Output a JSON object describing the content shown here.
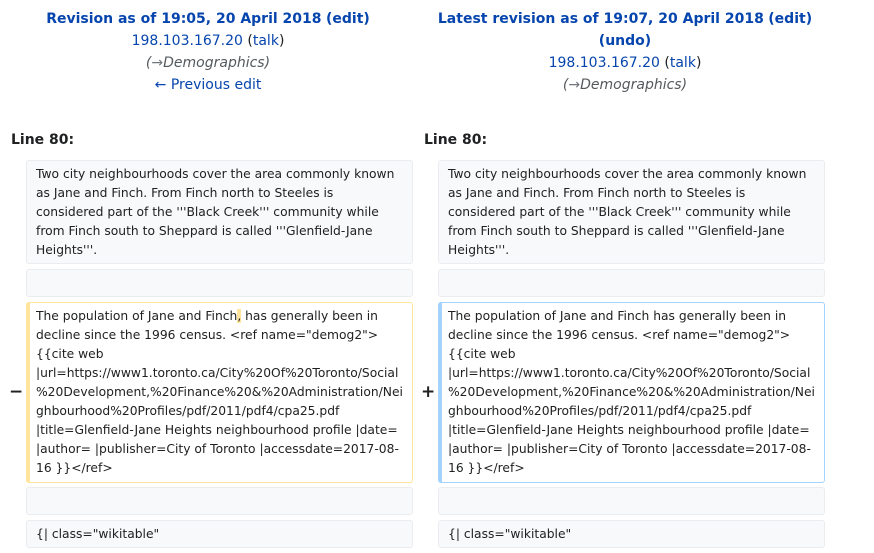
{
  "left_header": {
    "title": "Revision as of 19:05, 20 April 2018",
    "edit": "edit",
    "user": "198.103.167.20",
    "talk": "talk",
    "arrow": "→",
    "section": "Demographics",
    "prev": "← Previous edit"
  },
  "right_header": {
    "title": "Latest revision as of 19:07, 20 April 2018",
    "edit": "edit",
    "undo": "undo",
    "user": "198.103.167.20",
    "talk": "talk",
    "arrow": "→",
    "section": "Demographics"
  },
  "line_label": "Line 80:",
  "context_1": "Two city neighbourhoods cover the area commonly known as Jane and Finch. From Finch north to Steeles is considered part of the '''Black Creek''' community while from Finch south to Sheppard is called '''Glenfield-Jane Heights'''.",
  "deleted_before": "The population of Jane and Finch",
  "deleted_mark": ",",
  "deleted_after": " has generally been in decline since the 1996 census. <ref name=\"demog2\">{{cite web |url=https://www1.toronto.ca/City%20Of%20Toronto/Social%20Development,%20Finance%20&%20Administration/Neighbourhood%20Profiles/pdf/2011/pdf4/cpa25.pdf |title=Glenfield-Jane Heights neighbourhood profile |date= |author= |publisher=City of Toronto |accessdate=2017-08-16 }}</ref>",
  "added_text": "The population of Jane and Finch has generally been in decline since the 1996 census. <ref name=\"demog2\">{{cite web |url=https://www1.toronto.ca/City%20Of%20Toronto/Social%20Development,%20Finance%20&%20Administration/Neighbourhood%20Profiles/pdf/2011/pdf4/cpa25.pdf |title=Glenfield-Jane Heights neighbourhood profile |date= |author= |publisher=City of Toronto |accessdate=2017-08-16 }}</ref>",
  "minus": "−",
  "plus": "+",
  "context_2": "{| class=\"wikitable\""
}
